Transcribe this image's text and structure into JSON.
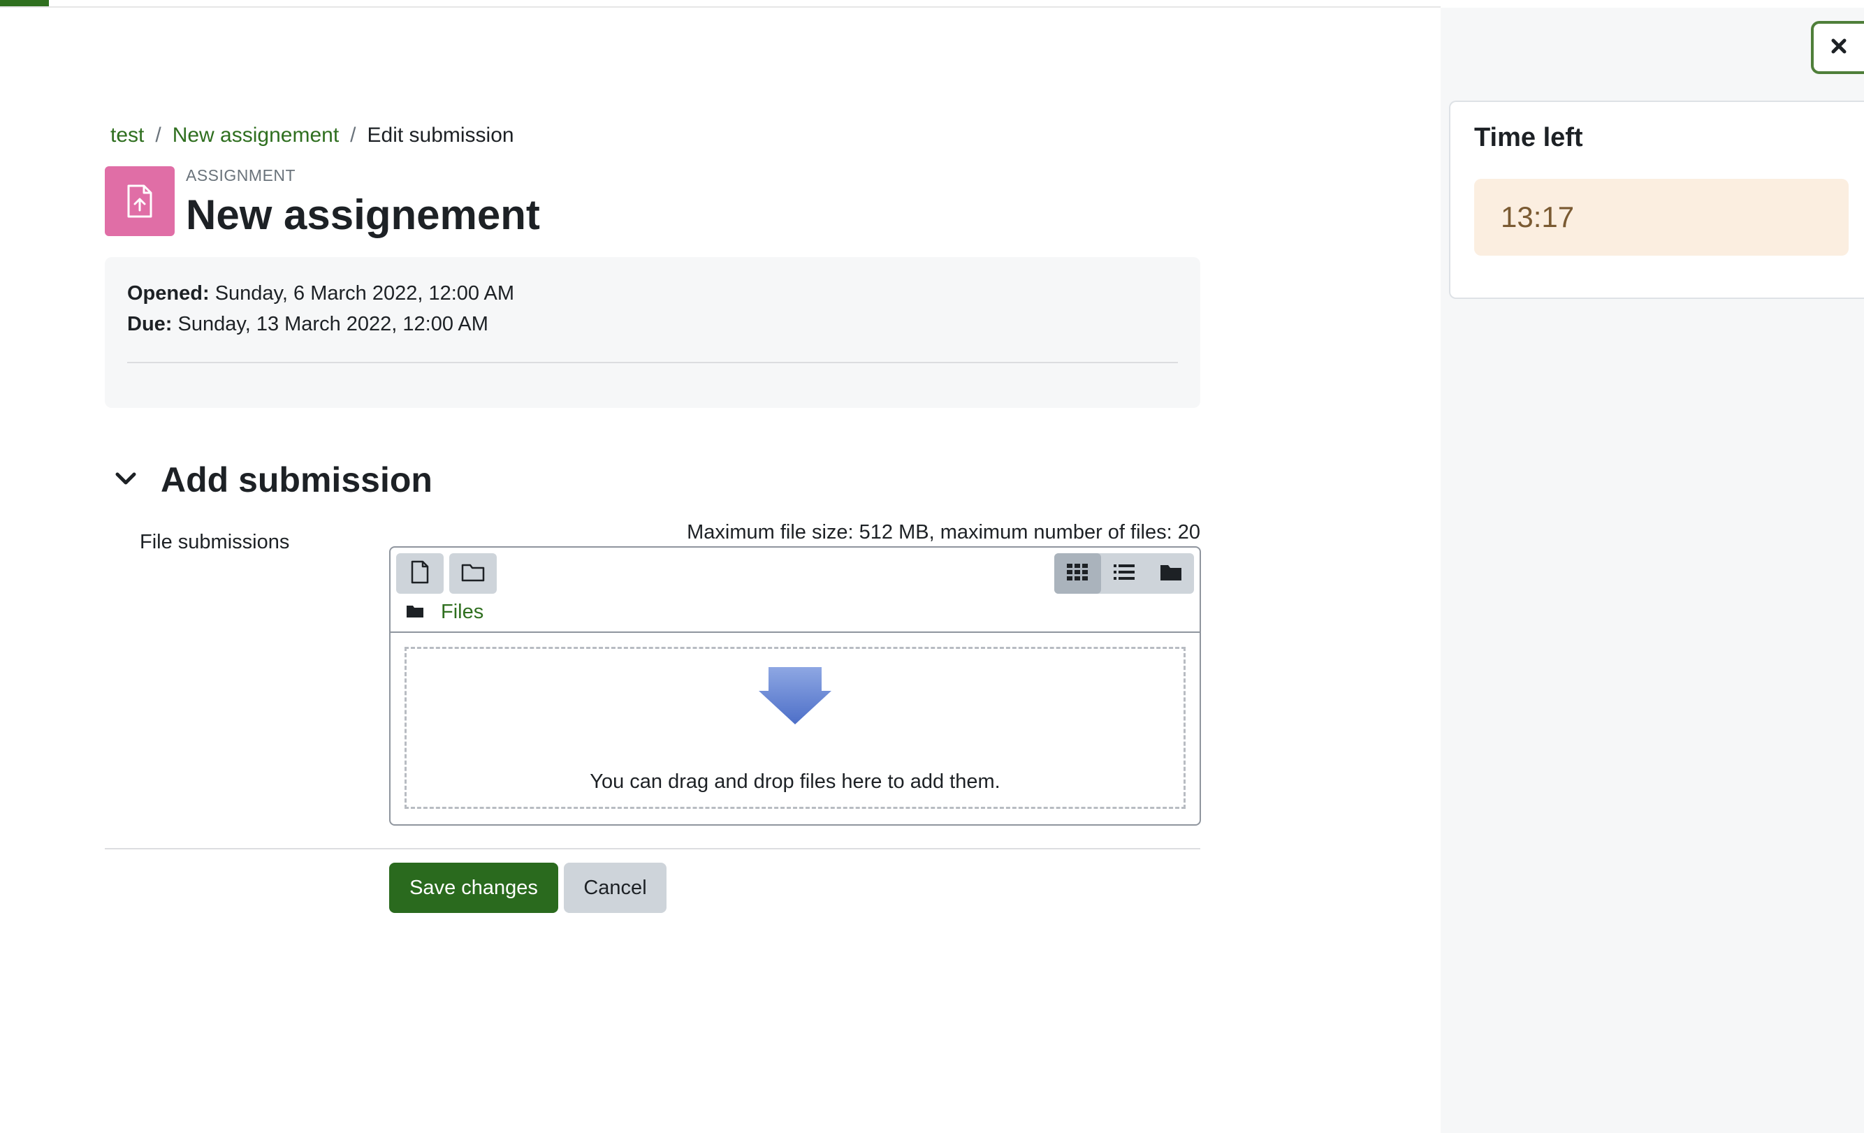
{
  "breadcrumb": {
    "items": [
      {
        "label": "test"
      },
      {
        "label": "New assignement"
      }
    ],
    "current": "Edit submission",
    "separator": "/"
  },
  "activity": {
    "type_label": "ASSIGNMENT",
    "title": "New assignement",
    "icon": "assignment-upload-icon",
    "icon_color": "#e06ea6"
  },
  "dates": {
    "opened_label": "Opened:",
    "opened_value": "Sunday, 6 March 2022, 12:00 AM",
    "due_label": "Due:",
    "due_value": "Sunday, 13 March 2022, 12:00 AM"
  },
  "submission": {
    "section_title": "Add submission",
    "field_label": "File submissions",
    "limits": "Maximum file size: 512 MB, maximum number of files: 20",
    "path_label": "Files",
    "drop_text": "You can drag and drop files here to add them."
  },
  "actions": {
    "save_label": "Save changes",
    "cancel_label": "Cancel"
  },
  "timer": {
    "title": "Time left",
    "value": "13:17"
  },
  "colors": {
    "brand": "#2f6f1f",
    "primary_button": "#2a6a1e",
    "timer_bg": "#fbeee0"
  }
}
